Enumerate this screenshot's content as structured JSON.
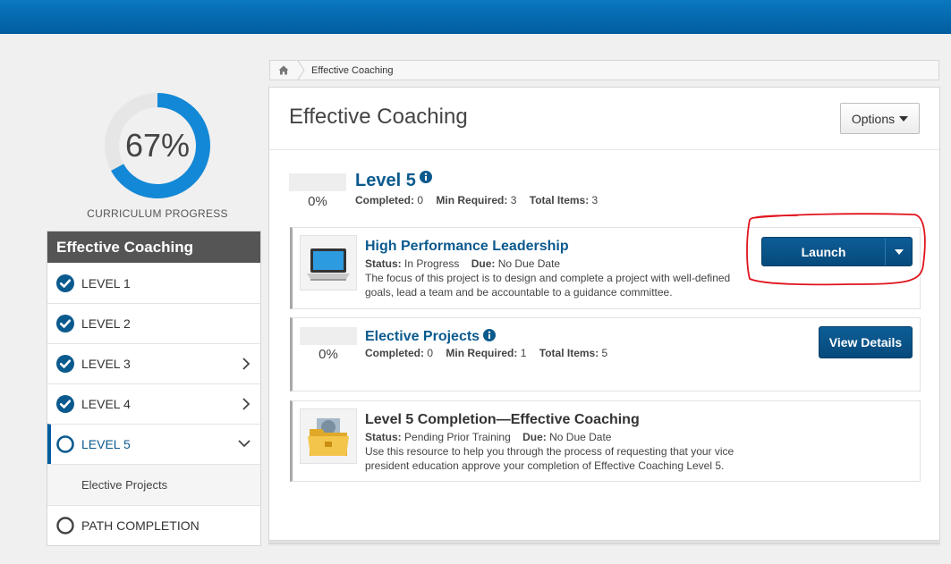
{
  "header": {
    "bar_color": "#0a78c0"
  },
  "progress": {
    "percent_label": "67%",
    "value": 0.67,
    "caption": "CURRICULUM PROGRESS",
    "color": "#1388d6",
    "track_color": "#e6e6e6"
  },
  "sidebar": {
    "title": "Effective Coaching",
    "items": [
      {
        "label": "LEVEL 1",
        "state": "complete",
        "icon": "check-circle-icon"
      },
      {
        "label": "LEVEL 2",
        "state": "complete",
        "icon": "check-circle-icon"
      },
      {
        "label": "LEVEL 3",
        "state": "complete",
        "icon": "check-circle-icon",
        "expandable": true
      },
      {
        "label": "LEVEL 4",
        "state": "complete",
        "icon": "check-circle-icon",
        "expandable": true
      },
      {
        "label": "LEVEL 5",
        "state": "active",
        "icon": "empty-circle-icon",
        "expanded": true
      },
      {
        "label": "PATH COMPLETION",
        "state": "incomplete",
        "icon": "empty-circle-icon"
      }
    ],
    "subitem": "Elective Projects"
  },
  "breadcrumb": {
    "home_icon": "home-icon",
    "current": "Effective Coaching"
  },
  "panel": {
    "title": "Effective Coaching",
    "options_label": "Options"
  },
  "level": {
    "title": "Level 5",
    "percent": "0%",
    "completed_label": "Completed:",
    "completed_value": "0",
    "min_label": "Min Required:",
    "min_value": "3",
    "total_label": "Total Items:",
    "total_value": "3"
  },
  "cards": [
    {
      "title": "High Performance Leadership",
      "status_label": "Status:",
      "status_value": "In Progress",
      "due_label": "Due:",
      "due_value": "No Due Date",
      "description": "The focus of this project is to design and complete a project with well-defined goals, lead a team and be accountable to a guidance committee.",
      "button": "Launch",
      "icon": "laptop-icon"
    },
    {
      "title": "Elective Projects",
      "percent": "0%",
      "completed_label": "Completed:",
      "completed_value": "0",
      "min_label": "Min Required:",
      "min_value": "1",
      "total_label": "Total Items:",
      "total_value": "5",
      "button": "View Details"
    },
    {
      "title": "Level 5 Completion—Effective Coaching",
      "status_label": "Status:",
      "status_value": "Pending Prior Training",
      "due_label": "Due:",
      "due_value": "No Due Date",
      "description": "Use this resource to help you through the process of requesting that your vice president education approve your completion of Effective Coaching Level 5.",
      "icon": "folder-icon"
    }
  ],
  "colors": {
    "accent": "#0b5a8e",
    "button": "#064a7c",
    "annotation": "#e0141e"
  }
}
